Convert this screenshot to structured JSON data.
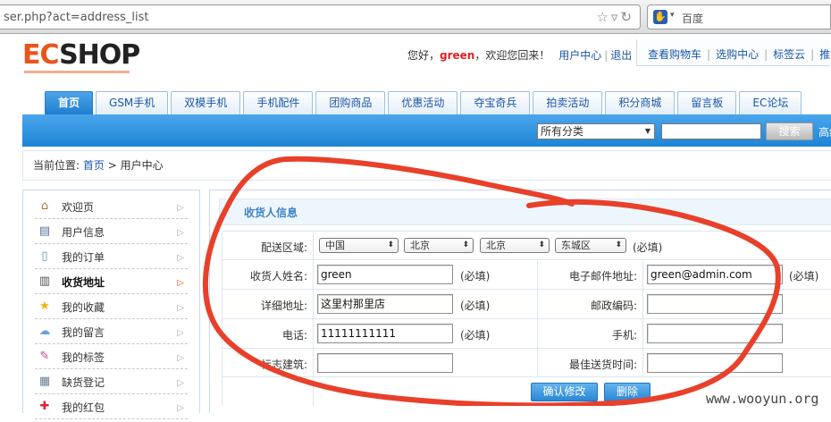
{
  "browser": {
    "url": "ser.php?act=address_list",
    "search_placeholder": "百度"
  },
  "logo": {
    "part1": "EC",
    "part2": "SHOP"
  },
  "header": {
    "greeting_prefix": "您好，",
    "username": "green",
    "greeting_suffix": "，欢迎您回来！",
    "user_center": "用户中心",
    "logout": "退出",
    "cart": "查看购物车",
    "buy_center": "选购中心",
    "tag_cloud": "标签云",
    "more": "推"
  },
  "nav": {
    "items": [
      "首页",
      "GSM手机",
      "双模手机",
      "手机配件",
      "团购商品",
      "优惠活动",
      "夺宝奇兵",
      "拍卖活动",
      "积分商城",
      "留言板",
      "EC论坛"
    ]
  },
  "search": {
    "category": "所有分类",
    "button": "搜索",
    "advanced": "高级"
  },
  "breadcrumb": {
    "prefix": "当前位置:",
    "home": "首页",
    "sep": ">",
    "current": "用户中心"
  },
  "sidebar": {
    "items": [
      {
        "label": "欢迎页",
        "icon": "home-icon"
      },
      {
        "label": "用户信息",
        "icon": "id-card-icon"
      },
      {
        "label": "我的订单",
        "icon": "document-icon"
      },
      {
        "label": "收货地址",
        "icon": "address-book-icon"
      },
      {
        "label": "我的收藏",
        "icon": "star-icon"
      },
      {
        "label": "我的留言",
        "icon": "speech-bubble-icon"
      },
      {
        "label": "我的标签",
        "icon": "tag-icon"
      },
      {
        "label": "缺货登记",
        "icon": "clipboard-icon"
      },
      {
        "label": "我的红包",
        "icon": "gift-icon"
      }
    ]
  },
  "form": {
    "title": "收货人信息",
    "region_label": "配送区域:",
    "country": "中国",
    "province": "北京",
    "city": "北京",
    "district": "东城区",
    "required": "(必填)",
    "consignee_label": "收货人姓名:",
    "consignee": "green",
    "email_label": "电子邮件地址:",
    "email": "green@admin.com",
    "address_label": "详细地址:",
    "address": "这里村那里店",
    "zipcode_label": "邮政编码:",
    "zipcode": "",
    "tel_label": "电话:",
    "tel": "11111111111",
    "mobile_label": "手机:",
    "mobile": "",
    "sign_label": "标志建筑:",
    "sign_building": "",
    "best_time_label": "最佳送货时间:",
    "best_time": "",
    "confirm_button": "确认修改",
    "delete_button": "删除"
  },
  "watermark": "www.wooyun.org",
  "colors": {
    "accent": "#1e84d4",
    "annotation": "#e8402a",
    "logo_orange": "#e8541c"
  }
}
